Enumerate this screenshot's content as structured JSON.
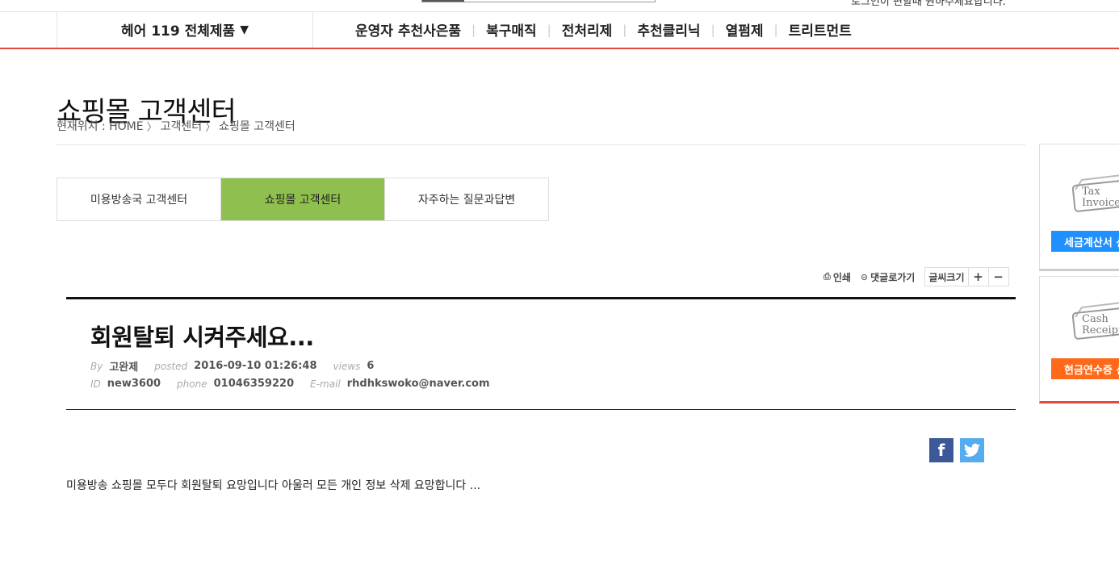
{
  "top": {
    "cut_text": "로그인이 편할때 원하주세요합니다."
  },
  "nav": {
    "all_products": "헤어 119 전체제품",
    "all_products_arrow": "▼",
    "menu": [
      "운영자 추천사은품",
      "복구매직",
      "전처리제",
      "추천클리닉",
      "열펌제",
      "트리트먼트"
    ],
    "separator": "|"
  },
  "page": {
    "title": "쇼핑몰 고객센터",
    "breadcrumb": {
      "prefix": "현재위치 : HOME",
      "chevron": "〉",
      "level1": "고객센터",
      "level2": "쇼핑몰 고객센터"
    }
  },
  "tabs": [
    "미용방송국 고객센터",
    "쇼핑몰 고객센터",
    "자주하는 질문과답변"
  ],
  "active_tab_index": 1,
  "colors": {
    "accent": "#e8463c",
    "active_tab": "#8fbf4e",
    "facebook": "#3b5998",
    "twitter": "#55acee",
    "tax_button": "#1e90ff",
    "cash_button": "#ff6a1a"
  },
  "tools": {
    "print": "인쇄",
    "print_icon": "printer-icon",
    "comment": "댓글로가기",
    "comment_icon": "comment-icon",
    "font_size": "글씨크기",
    "plus": "+",
    "minus": "−"
  },
  "post": {
    "title": "회원탈퇴 시켜주세요...",
    "by_label": "By",
    "author": "고완제",
    "posted_label": "posted",
    "posted": "2016-09-10 01:26:48",
    "views_label": "views",
    "views": "6",
    "id_label": "ID",
    "user_id": "new3600",
    "phone_label": "phone",
    "phone": "01046359220",
    "email_label": "E-mail",
    "email": "rhdhkswoko@naver.com",
    "body": "미용방송 쇼핑몰 모두다 회원탈퇴 요망입니다 아울러 모든 개인 정보 삭제 요망합니다 ..."
  },
  "share": {
    "facebook": "f",
    "twitter": "t"
  },
  "quick": {
    "tax_card_line1": "Tax",
    "tax_card_line2": "Invoice",
    "tax_button": "세금계산서 신",
    "cash_card_line1": "Cash",
    "cash_card_line2": "Receipt",
    "cash_button": "현금연수증 신"
  }
}
